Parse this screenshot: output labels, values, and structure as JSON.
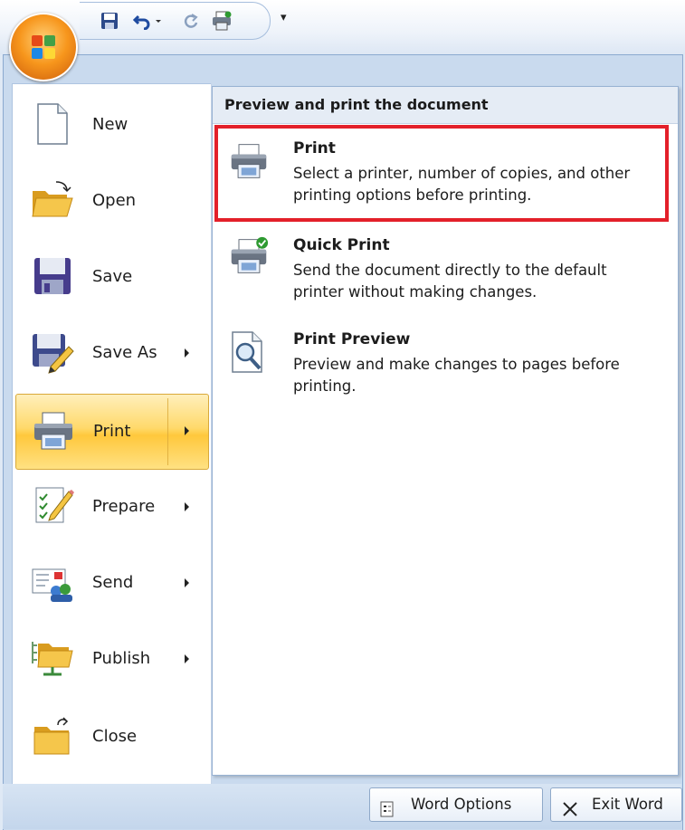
{
  "quick_access": {
    "icons": [
      "save-icon",
      "undo-icon",
      "undo-dropdown-icon",
      "redo-icon",
      "quick-print-icon"
    ],
    "more_glyph": "▾"
  },
  "menu": {
    "left_items": [
      {
        "label": "New",
        "icon": "new-document-icon",
        "submenu": false
      },
      {
        "label": "Open",
        "icon": "open-folder-icon",
        "submenu": false
      },
      {
        "label": "Save",
        "icon": "save-disk-icon",
        "submenu": false
      },
      {
        "label": "Save As",
        "icon": "save-as-icon",
        "submenu": true
      },
      {
        "label": "Print",
        "icon": "print-icon",
        "submenu": true,
        "active": true
      },
      {
        "label": "Prepare",
        "icon": "prepare-icon",
        "submenu": true
      },
      {
        "label": "Send",
        "icon": "send-icon",
        "submenu": true
      },
      {
        "label": "Publish",
        "icon": "publish-icon",
        "submenu": true
      },
      {
        "label": "Close",
        "icon": "close-folder-icon",
        "submenu": false
      }
    ],
    "right_panel": {
      "header": "Preview and print the document",
      "items": [
        {
          "title": "Print",
          "description": "Select a printer, number of copies, and other printing options before printing.",
          "icon": "printer-icon",
          "highlighted": true
        },
        {
          "title": "Quick Print",
          "description": "Send the document directly to the default printer without making changes.",
          "icon": "quick-print-icon"
        },
        {
          "title": "Print Preview",
          "description": "Preview and make changes to pages before printing.",
          "icon": "print-preview-icon"
        }
      ]
    }
  },
  "bottom_bar": {
    "word_options": "Word Options",
    "exit_word": "Exit Word"
  },
  "colors": {
    "active_item_top": "#ffefbb",
    "active_item_bottom": "#ffc83c",
    "highlight_box": "#e3202a",
    "frame": "#c9daee"
  }
}
